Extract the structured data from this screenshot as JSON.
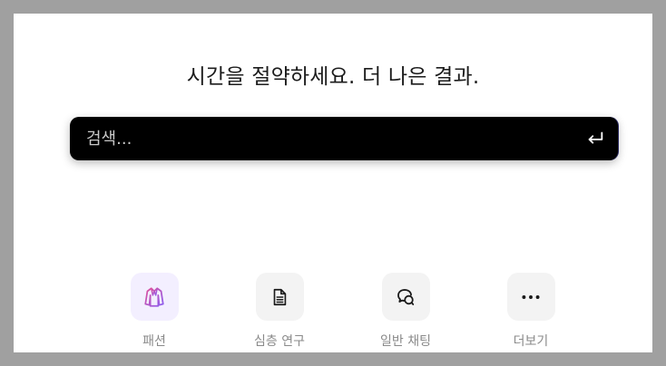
{
  "headline": "시간을 절약하세요. 더 나은 결과.",
  "search": {
    "placeholder": "검색...",
    "value": "",
    "submit_icon": "enter-icon"
  },
  "quick_actions": [
    {
      "label": "패션",
      "icon": "coat-icon",
      "selected": true
    },
    {
      "label": "심층 연구",
      "icon": "document-icon",
      "selected": false
    },
    {
      "label": "일반 채팅",
      "icon": "chat-bubbles-icon",
      "selected": false
    },
    {
      "label": "더보기",
      "icon": "more-dots-icon",
      "selected": false
    }
  ],
  "colors": {
    "accent": "#c05fd0",
    "search_bg": "#000000",
    "tile_bg": "#f3f3f3",
    "tile_selected_bg": "#f3efff",
    "label": "#8a8a8a"
  }
}
